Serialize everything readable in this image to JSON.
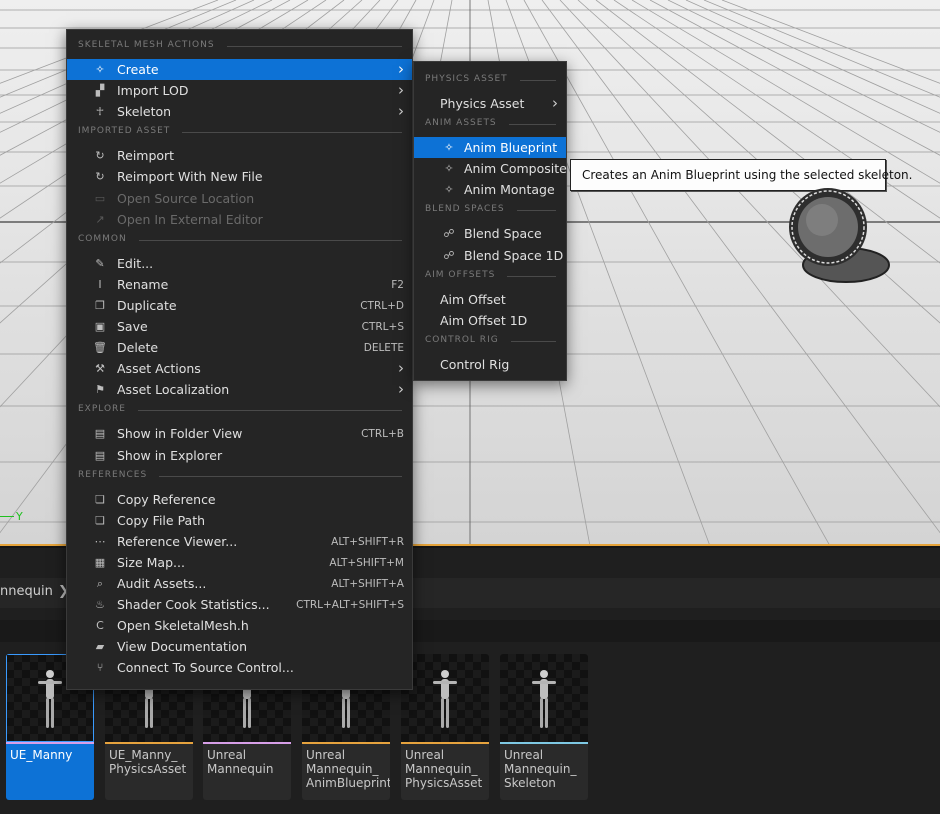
{
  "viewport": {
    "axis_label": "Y"
  },
  "menu": {
    "sections": [
      {
        "header": "SKELETAL MESH ACTIONS",
        "items": [
          {
            "icon": "create-icon",
            "label": "Create",
            "arrow": true,
            "highlighted": true
          },
          {
            "icon": "import-lod-icon",
            "label": "Import LOD",
            "arrow": true
          },
          {
            "icon": "skeleton-icon",
            "label": "Skeleton",
            "arrow": true
          }
        ]
      },
      {
        "header": "IMPORTED ASSET",
        "items": [
          {
            "icon": "reimport-icon",
            "label": "Reimport"
          },
          {
            "icon": "reimport-new-file-icon",
            "label": "Reimport With New File"
          },
          {
            "icon": "open-source-icon",
            "label": "Open Source Location",
            "disabled": true
          },
          {
            "icon": "external-editor-icon",
            "label": "Open In External Editor",
            "disabled": true
          }
        ]
      },
      {
        "header": "COMMON",
        "items": [
          {
            "icon": "edit-icon",
            "label": "Edit..."
          },
          {
            "icon": "rename-icon",
            "label": "Rename",
            "shortcut": "F2"
          },
          {
            "icon": "duplicate-icon",
            "label": "Duplicate",
            "shortcut": "CTRL+D"
          },
          {
            "icon": "save-icon",
            "label": "Save",
            "shortcut": "CTRL+S"
          },
          {
            "icon": "delete-icon",
            "label": "Delete",
            "shortcut": "DELETE"
          },
          {
            "icon": "wrench-icon",
            "label": "Asset Actions",
            "arrow": true
          },
          {
            "icon": "flag-icon",
            "label": "Asset Localization",
            "arrow": true
          }
        ]
      },
      {
        "header": "EXPLORE",
        "items": [
          {
            "icon": "folder-search-icon",
            "label": "Show in Folder View",
            "shortcut": "CTRL+B"
          },
          {
            "icon": "folder-search-icon",
            "label": "Show in Explorer"
          }
        ]
      },
      {
        "header": "REFERENCES",
        "items": [
          {
            "icon": "copy-reference-icon",
            "label": "Copy Reference"
          },
          {
            "icon": "copy-path-icon",
            "label": "Copy File Path"
          },
          {
            "icon": "reference-viewer-icon",
            "label": "Reference Viewer...",
            "shortcut": "ALT+SHIFT+R"
          },
          {
            "icon": "size-map-icon",
            "label": "Size Map...",
            "shortcut": "ALT+SHIFT+M"
          },
          {
            "icon": "audit-icon",
            "label": "Audit Assets...",
            "shortcut": "ALT+SHIFT+A"
          },
          {
            "icon": "shader-cook-icon",
            "label": "Shader Cook Statistics...",
            "shortcut": "CTRL+ALT+SHIFT+S"
          },
          {
            "icon": "cpp-file-icon",
            "label": "Open SkeletalMesh.h"
          },
          {
            "icon": "documentation-icon",
            "label": "View Documentation"
          },
          {
            "icon": "source-control-icon",
            "label": "Connect To Source Control..."
          }
        ]
      }
    ]
  },
  "submenu": {
    "sections": [
      {
        "header": "PHYSICS ASSET",
        "items": [
          {
            "label": "Physics Asset",
            "arrow": true
          }
        ]
      },
      {
        "header": "ANIM ASSETS",
        "items": [
          {
            "icon": "anim-blueprint-icon",
            "label": "Anim Blueprint",
            "highlighted": true
          },
          {
            "icon": "anim-composite-icon",
            "label": "Anim Composite"
          },
          {
            "icon": "anim-montage-icon",
            "label": "Anim Montage"
          }
        ]
      },
      {
        "header": "BLEND SPACES",
        "items": [
          {
            "icon": "blend-space-icon",
            "label": "Blend Space"
          },
          {
            "icon": "blend-space-1d-icon",
            "label": "Blend Space 1D"
          }
        ]
      },
      {
        "header": "AIM OFFSETS",
        "items": [
          {
            "label": "Aim Offset"
          },
          {
            "label": "Aim Offset 1D"
          }
        ]
      },
      {
        "header": "CONTROL RIG",
        "items": [
          {
            "label": "Control Rig"
          }
        ]
      }
    ]
  },
  "tooltip": {
    "text": "Creates an Anim Blueprint using the selected skeleton."
  },
  "content_browser": {
    "path": "nnequin",
    "path_chevron": "❯",
    "assets": [
      {
        "name": "UE_Manny",
        "color": "#d79fe8",
        "selected": true
      },
      {
        "name": "UE_Manny_\nPhysicsAsset",
        "color": "#e6a33e"
      },
      {
        "name": "Unreal\nMannequin",
        "color": "#d79fe8"
      },
      {
        "name": "Unreal\nMannequin_\nAnimBlueprint",
        "color": "#e6a33e"
      },
      {
        "name": "Unreal\nMannequin_\nPhysicsAsset",
        "color": "#e6a33e"
      },
      {
        "name": "Unreal\nMannequin_\nSkeleton",
        "color": "#7ec8e3"
      }
    ]
  }
}
